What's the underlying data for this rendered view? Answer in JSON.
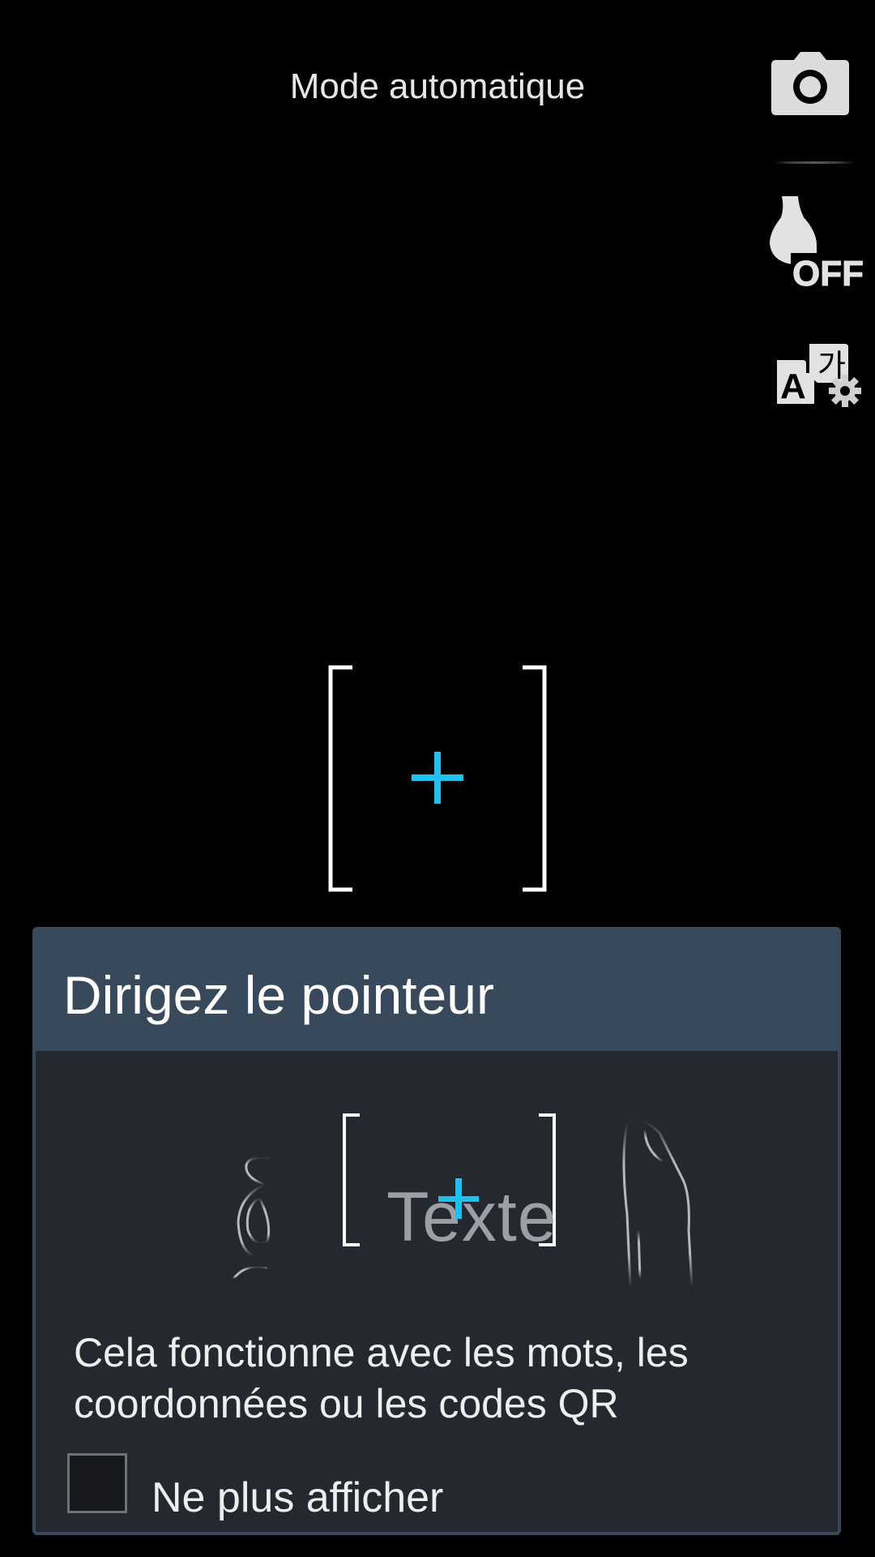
{
  "header": {
    "mode_title": "Mode automatique"
  },
  "side_controls": {
    "capture_icon": "camera-icon",
    "flash_icon": "flash-off-icon",
    "flash_state": "OFF",
    "language_icon": "language-settings-icon",
    "language_glyphs": {
      "latin": "A",
      "korean": "가"
    }
  },
  "viewfinder": {
    "pointer_color": "#1ec0ee"
  },
  "dialog": {
    "title": "Dirigez le pointeur",
    "illustration_word": "Texte",
    "description": "Cela fonctionne avec les mots, les coordonnées ou les codes QR",
    "checkbox_label": "Ne plus afficher",
    "checkbox_checked": false
  },
  "colors": {
    "dialog_header": "#37495a",
    "dialog_body": "#23292e",
    "accent": "#1ec0ee"
  }
}
